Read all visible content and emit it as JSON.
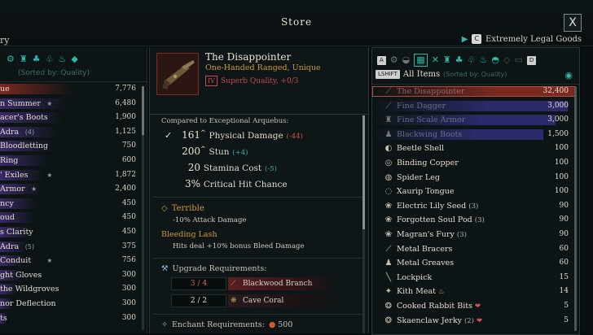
{
  "header": {
    "title": "Store",
    "close_label": "X",
    "left_cut_text": "ry",
    "vendor_key": "C",
    "vendor_name": "Extremely Legal Goods"
  },
  "left_panel": {
    "sort_label": "(Sorted by: Quality)",
    "items": [
      {
        "name": "ue",
        "price": "7,776",
        "bar": "#7a2820",
        "bar_w": 60,
        "star": false
      },
      {
        "name": "n Summer",
        "price": "6,480",
        "bar": "#3a2a66",
        "bar_w": 55,
        "star": true
      },
      {
        "name": "acer's Boots",
        "price": "1,900",
        "bar": "#3a2a66",
        "bar_w": 52,
        "star": false
      },
      {
        "name": "Adra",
        "count": "(4)",
        "price": "1,125",
        "bar": "#3a2a66",
        "bar_w": 48,
        "star": false
      },
      {
        "name": "Bloodletting",
        "price": "750",
        "bar": "#3a2a66",
        "bar_w": 45,
        "star": false
      },
      {
        "name": "Ring",
        "price": "600",
        "bar": "#3a2a66",
        "bar_w": 40,
        "star": false
      },
      {
        "name": "' Exiles",
        "price": "1,872",
        "bar": "#3a2a66",
        "bar_w": 36,
        "star": true
      },
      {
        "name": "Armor",
        "price": "2,400",
        "bar": "#3a2a66",
        "bar_w": 34,
        "star": true
      },
      {
        "name": "ncy",
        "price": "450",
        "bar": "#3a2a66",
        "bar_w": 30,
        "star": false
      },
      {
        "name": "oud",
        "price": "450",
        "bar": "#3a2a66",
        "bar_w": 28,
        "star": false
      },
      {
        "name": "s Clarity",
        "price": "450",
        "bar": "#3a2a66",
        "bar_w": 25,
        "star": false
      },
      {
        "name": "Adra",
        "count": "(5)",
        "price": "375",
        "bar": "#3a2a66",
        "bar_w": 22,
        "star": false
      },
      {
        "name": " Conduit",
        "price": "756",
        "bar": "#3a2a66",
        "bar_w": 20,
        "star": true
      },
      {
        "name": "ght Gloves",
        "price": "300",
        "bar": "#3a2a66",
        "bar_w": 18,
        "star": false
      },
      {
        "name": " the Wildgroves",
        "price": "300",
        "bar": "#3a2a66",
        "bar_w": 14,
        "star": false
      },
      {
        "name": "nor Deflection",
        "price": "300",
        "bar": "#3a2a66",
        "bar_w": 10,
        "star": false
      },
      {
        "name": "ts",
        "price": "300",
        "bar": "#3a2a66",
        "bar_w": 6,
        "star": false
      }
    ]
  },
  "detail": {
    "name": "The Disappointer",
    "type": "One-Handed Ranged, Unique",
    "quality_tier": "IV",
    "quality": "Superb Quality, +0/3",
    "compared_to": "Compared to Exceptional Arquebus:",
    "stats": [
      {
        "value": "161",
        "suffix": "^",
        "label": "Physical Damage",
        "delta": "(-44)",
        "delta_kind": "neg",
        "check": true
      },
      {
        "value": "200",
        "suffix": "^",
        "label": "Stun",
        "delta": "(+4)",
        "delta_kind": "pos",
        "check": false
      },
      {
        "value": "20",
        "suffix": "",
        "label": "Stamina Cost",
        "delta": "(-5)",
        "delta_kind": "pos",
        "check": false
      },
      {
        "value": "3%",
        "suffix": "",
        "label": "Critical Hit Chance",
        "delta": "",
        "delta_kind": "",
        "check": false
      }
    ],
    "terrible_title": "Terrible",
    "terrible_desc": "-10% Attack Damage",
    "bleed_title": "Bleeding Lash",
    "bleed_desc": "Hits deal +10% bonus Bleed Damage",
    "upgrade_title": "Upgrade Requirements:",
    "requirements": [
      {
        "count": "3 / 4",
        "name": "Blackwood Branch",
        "insufficient": true
      },
      {
        "count": "2 / 2",
        "name": "Cave Coral",
        "insufficient": false
      }
    ],
    "enchant_title": "Enchant Requirements:",
    "enchant_cost": "500"
  },
  "right_panel": {
    "key_left": "A",
    "key_right": "D",
    "shift_key": "LSHIFT",
    "tab_label": "All Items",
    "sort_label": "(Sorted by: Quality)",
    "items": [
      {
        "icon": "gun-icon",
        "glyph": "⟋",
        "name": "The Disappointer",
        "price": "32,400",
        "bar": "#7a2820",
        "bar_w": 250,
        "style": "dim",
        "selected": true
      },
      {
        "icon": "dagger-icon",
        "glyph": "⟋",
        "name": "Fine Dagger",
        "price": "3,000",
        "bar": "#2c2a6a",
        "bar_w": 240,
        "style": "dimb",
        "selected": false
      },
      {
        "icon": "armor-icon",
        "glyph": "♜",
        "name": "Fine Scale Armor",
        "price": "3,000",
        "bar": "#2c2a6a",
        "bar_w": 225,
        "style": "dimb",
        "selected": false
      },
      {
        "icon": "boots-icon",
        "glyph": "♟",
        "name": "Blackwing Boots",
        "price": "1,500",
        "bar": "#2c2a6a",
        "bar_w": 210,
        "style": "dimb",
        "selected": false
      },
      {
        "icon": "shell-icon",
        "glyph": "◐",
        "name": "Beetle Shell",
        "price": "100"
      },
      {
        "icon": "copper-icon",
        "glyph": "◎",
        "name": "Binding Copper",
        "price": "100"
      },
      {
        "icon": "leg-icon",
        "glyph": "◍",
        "name": "Spider Leg",
        "price": "100"
      },
      {
        "icon": "tongue-icon",
        "glyph": "◌",
        "name": "Xaurip Tongue",
        "price": "100"
      },
      {
        "icon": "seed-icon",
        "glyph": "❀",
        "name": "Electric Lily Seed",
        "count": "(3)",
        "price": "90"
      },
      {
        "icon": "pod-icon",
        "glyph": "❀",
        "name": "Forgotten Soul Pod",
        "count": "(3)",
        "price": "90"
      },
      {
        "icon": "fury-icon",
        "glyph": "❀",
        "name": "Magran's Fury",
        "count": "(3)",
        "price": "90"
      },
      {
        "icon": "bracers-icon",
        "glyph": "⟋",
        "name": "Metal Bracers",
        "price": "60"
      },
      {
        "icon": "greaves-icon",
        "glyph": "♟",
        "name": "Metal Greaves",
        "price": "60"
      },
      {
        "icon": "lockpick-icon",
        "glyph": "╲",
        "name": "Lockpick",
        "price": "15"
      },
      {
        "icon": "meat-icon",
        "glyph": "✦",
        "name": "Kith Meat",
        "extra": "♨",
        "extra_color": "#d4b33a",
        "price": "14"
      },
      {
        "icon": "rabbit-icon",
        "glyph": "❂",
        "name": "Cooked Rabbit Bits",
        "extra": "❤",
        "extra_color": "#d05060",
        "price": "5"
      },
      {
        "icon": "jerky-icon",
        "glyph": "❂",
        "name": "Skaenclaw Jerky",
        "count": "(2)",
        "extra": "❤",
        "extra_color": "#d05060",
        "price": "5"
      }
    ]
  },
  "colors": {
    "accent": "#2fb6a6",
    "gold": "#cf9a37",
    "danger": "#c74b4b"
  }
}
